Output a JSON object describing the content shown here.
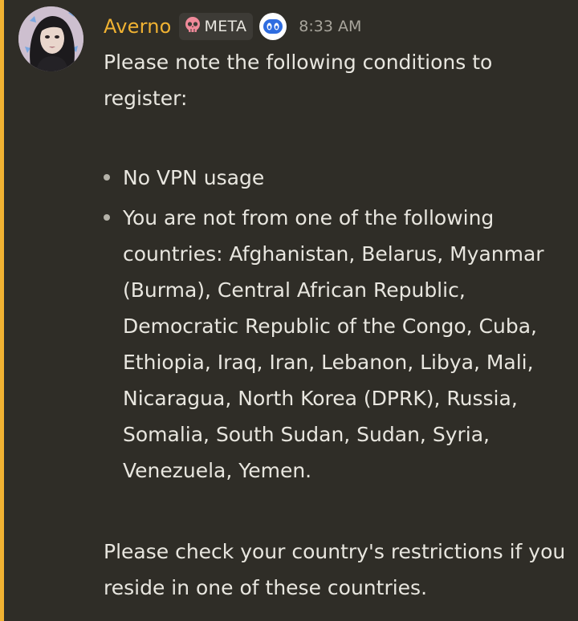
{
  "message": {
    "author": "Averno",
    "author_color": "#f0b232",
    "role_tag": {
      "icon": "skull-icon",
      "label": "META"
    },
    "app_badge_icon": "bot-face-icon",
    "timestamp": "8:33 AM",
    "paragraph_1": "Please note the following conditions to register:",
    "bullets": [
      "No VPN usage",
      "You are not from one of the following countries: Afghanistan, Belarus, Myanmar (Burma), Central African Republic, Democratic Republic of the Congo, Cuba, Ethiopia, Iraq, Iran, Lebanon, Libya, Mali, Nicaragua, North Korea (DPRK), Russia, Somalia, South Sudan, Sudan, Syria, Venezuela, Yemen."
    ],
    "paragraph_2": "Please check your country's restrictions if you reside in one of these countries."
  },
  "colors": {
    "background": "#2f2d27",
    "mention_highlight": "#f0b232",
    "text": "#e8e6df",
    "muted": "#a8a59c"
  }
}
